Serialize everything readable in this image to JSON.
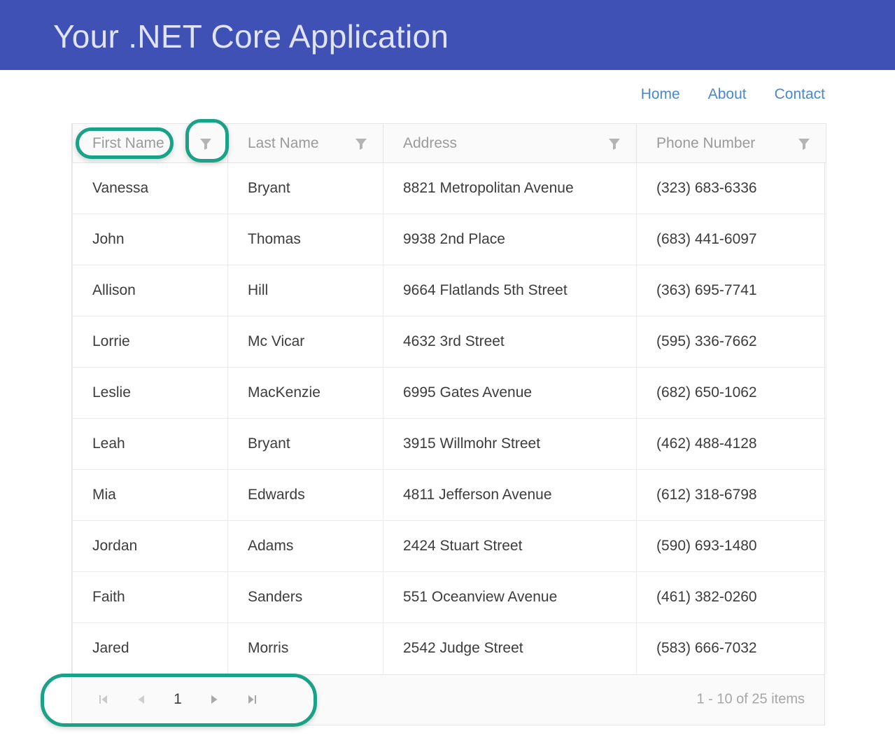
{
  "banner": {
    "title": "Your .NET Core Application",
    "background_color": "#3f51b5",
    "title_color": "#dfe3f4"
  },
  "nav": {
    "links": [
      {
        "label": "Home"
      },
      {
        "label": "About"
      },
      {
        "label": "Contact"
      }
    ],
    "link_color": "#4a88c7"
  },
  "grid": {
    "columns": [
      {
        "title": "First Name",
        "filter_icon": "filter-funnel-icon"
      },
      {
        "title": "Last Name",
        "filter_icon": "filter-funnel-icon"
      },
      {
        "title": "Address",
        "filter_icon": "filter-funnel-icon"
      },
      {
        "title": "Phone Number",
        "filter_icon": "filter-funnel-icon"
      }
    ],
    "rows": [
      {
        "first_name": "Vanessa",
        "last_name": "Bryant",
        "address": "8821 Metropolitan Avenue",
        "phone": "(323) 683-6336"
      },
      {
        "first_name": "John",
        "last_name": "Thomas",
        "address": "9938 2nd Place",
        "phone": "(683) 441-6097"
      },
      {
        "first_name": "Allison",
        "last_name": "Hill",
        "address": "9664 Flatlands 5th Street",
        "phone": "(363) 695-7741"
      },
      {
        "first_name": "Lorrie",
        "last_name": "Mc Vicar",
        "address": "4632 3rd Street",
        "phone": "(595) 336-7662"
      },
      {
        "first_name": "Leslie",
        "last_name": "MacKenzie",
        "address": "6995 Gates Avenue",
        "phone": "(682) 650-1062"
      },
      {
        "first_name": "Leah",
        "last_name": "Bryant",
        "address": "3915 Willmohr Street",
        "phone": "(462) 488-4128"
      },
      {
        "first_name": "Mia",
        "last_name": "Edwards",
        "address": "4811 Jefferson Avenue",
        "phone": "(612) 318-6798"
      },
      {
        "first_name": "Jordan",
        "last_name": "Adams",
        "address": "2424 Stuart Street",
        "phone": "(590) 693-1480"
      },
      {
        "first_name": "Faith",
        "last_name": "Sanders",
        "address": "551 Oceanview Avenue",
        "phone": "(461) 382-0260"
      },
      {
        "first_name": "Jared",
        "last_name": "Morris",
        "address": "2542 Judge Street",
        "phone": "(583) 666-7032"
      }
    ]
  },
  "pager": {
    "first_icon": "go-to-first-page-icon",
    "prev_icon": "go-to-previous-page-icon",
    "current_page": "1",
    "next_icon": "go-to-next-page-icon",
    "last_icon": "go-to-last-page-icon",
    "info": "1 - 10 of 25 items"
  },
  "annotations": {
    "color": "#19a287",
    "items": [
      {
        "target": "first-name-column-title"
      },
      {
        "target": "first-name-filter-icon"
      },
      {
        "target": "pager-navigation"
      }
    ]
  }
}
